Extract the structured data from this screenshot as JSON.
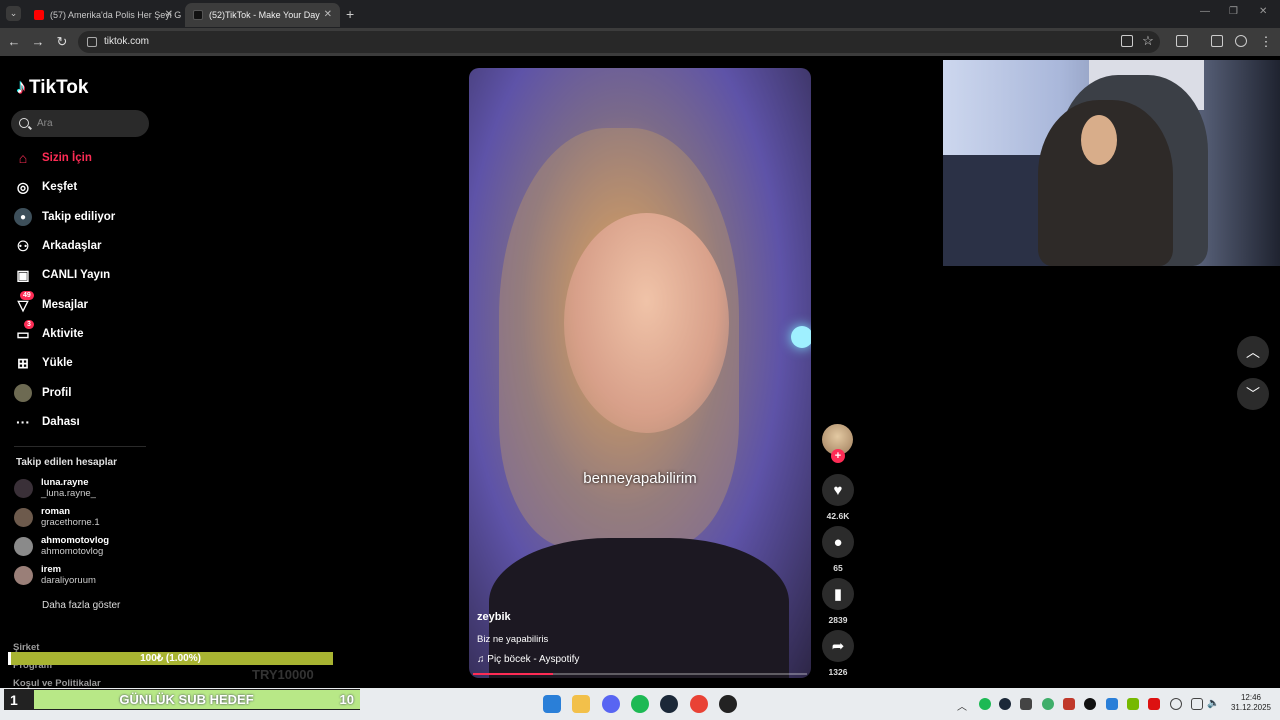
{
  "browser": {
    "tabs": [
      {
        "title": "(57) Amerika'da Polis Her Şeyi G",
        "active": false
      },
      {
        "title": "(52)TikTok - Make Your Day",
        "active": true
      }
    ],
    "url": "tiktok.com"
  },
  "sidebar": {
    "logo": "TikTok",
    "search_placeholder": "Ara",
    "nav": [
      {
        "label": "Sizin İçin",
        "icon": "home-icon",
        "active": true
      },
      {
        "label": "Keşfet",
        "icon": "compass-icon"
      },
      {
        "label": "Takip ediliyor",
        "icon": "following-icon"
      },
      {
        "label": "Arkadaşlar",
        "icon": "friends-icon"
      },
      {
        "label": "CANLI Yayın",
        "icon": "live-icon"
      },
      {
        "label": "Mesajlar",
        "icon": "messages-icon",
        "badge": "49"
      },
      {
        "label": "Aktivite",
        "icon": "activity-icon",
        "badge": "3"
      },
      {
        "label": "Yükle",
        "icon": "upload-icon"
      },
      {
        "label": "Profil",
        "icon": "profile-avatar"
      },
      {
        "label": "Dahası",
        "icon": "more-icon"
      }
    ],
    "following_title": "Takip edilen hesaplar",
    "accounts": [
      {
        "name": "luna.rayne",
        "handle": "_luna.rayne_"
      },
      {
        "name": "roman",
        "handle": "gracethorne.1"
      },
      {
        "name": "ahmomotovlog",
        "handle": "ahmomotovlog"
      },
      {
        "name": "irem",
        "handle": "daraliyoruum"
      }
    ],
    "more_accounts": "Daha fazla göster",
    "footer": [
      "Şirket",
      "Program",
      "Koşul ve Politikalar"
    ]
  },
  "overlay": {
    "donation_text": "100₺ (1.00%)",
    "donation_progress": 0.01,
    "donation_target": "TRY10000",
    "subgoal_count": "1",
    "subgoal_label": "GÜNLÜK SUB HEDEF",
    "subgoal_target": "10"
  },
  "video": {
    "caption": "benneyapabilirim",
    "author": "zeybik",
    "description": "Biz ne yapabiliris",
    "sound": "Piç böcek - Ayspotify",
    "progress": 0.24
  },
  "actions": {
    "likes": "42.6K",
    "comments": "65",
    "saves": "2839",
    "shares": "1326"
  },
  "clock": {
    "time": "12:46",
    "date": "31.12.2025"
  },
  "colors": {
    "accent": "#fe2c55",
    "background": "#000000",
    "sidebar_text": "#ffffff"
  }
}
